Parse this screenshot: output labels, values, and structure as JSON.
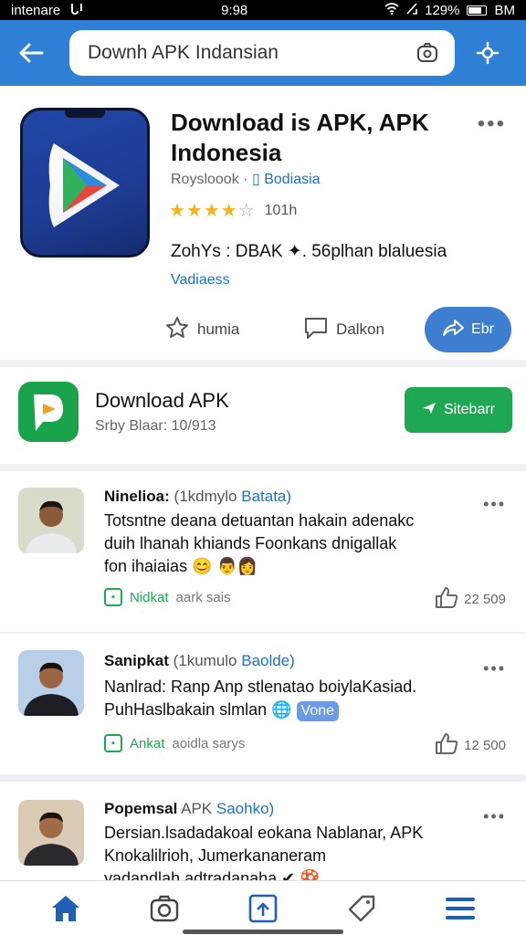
{
  "status_bar": {
    "carrier": "intenare",
    "time": "9:98",
    "battery": "129%",
    "right_text": "BM"
  },
  "search": {
    "query": "Downh APK Indansian"
  },
  "app": {
    "title": "Download is APK, APK Indonesia",
    "developer": "Roysloook",
    "region": "Bodiasia",
    "rating_count": "101h",
    "meta": "ZohYs : DBAK ✦. 56plhan blaluesia",
    "meta_link": "Vadiaess",
    "actions": {
      "favorite": "humia",
      "comment": "Dalkon",
      "primary": "Ebr"
    },
    "colors": {
      "accent": "#3d7ed1",
      "appbar": "#2e7fd6"
    }
  },
  "download_card": {
    "title": "Download APK",
    "subtitle": "Srby Blaar: 10/913",
    "button": "Sitebarr",
    "color": "#1fa854"
  },
  "posts": [
    {
      "name": "Ninelioa:",
      "handle": "(1kdmylo",
      "link": "Batata)",
      "body_line1": "Totsntne deana detuantan hakain adenakc",
      "body_line2": "duih lhanah khiands Foonkans dnigallak",
      "body_line3": "fon ihaiaias 😊 👨‍👩",
      "foot_green": "Nidkat",
      "foot_gray": "aark sais",
      "likes": "22 509"
    },
    {
      "name": "Sanipkat",
      "handle": "(1kumulo",
      "link": "Baolde)",
      "body_line1": "Nanlrad: Ranp Anp stlenatao boiylaKasiad.",
      "body_line2": "PuhHaslbakain slmlan",
      "tag": "Vone",
      "foot_green": "Ankat",
      "foot_gray": "aoidla sarys",
      "likes": "12 500"
    },
    {
      "name": "Popemsal",
      "handle": "APK",
      "link": "Saohko)",
      "body_line1": "Dersian.lsadadakoal eokana Nablanar, APK",
      "body_line2": "Knokalilrioh, Jumerkananeram",
      "body_line3": "yadandlah adtradanaha ✔ 🍄"
    }
  ],
  "icons": [
    "back-arrow-icon",
    "camera-lens-icon",
    "assistant-icon",
    "star-outline-icon",
    "comment-icon",
    "share-icon",
    "thumbs-up-icon",
    "home-icon",
    "camera-icon",
    "upload-icon",
    "tag-icon",
    "menu-icon"
  ]
}
